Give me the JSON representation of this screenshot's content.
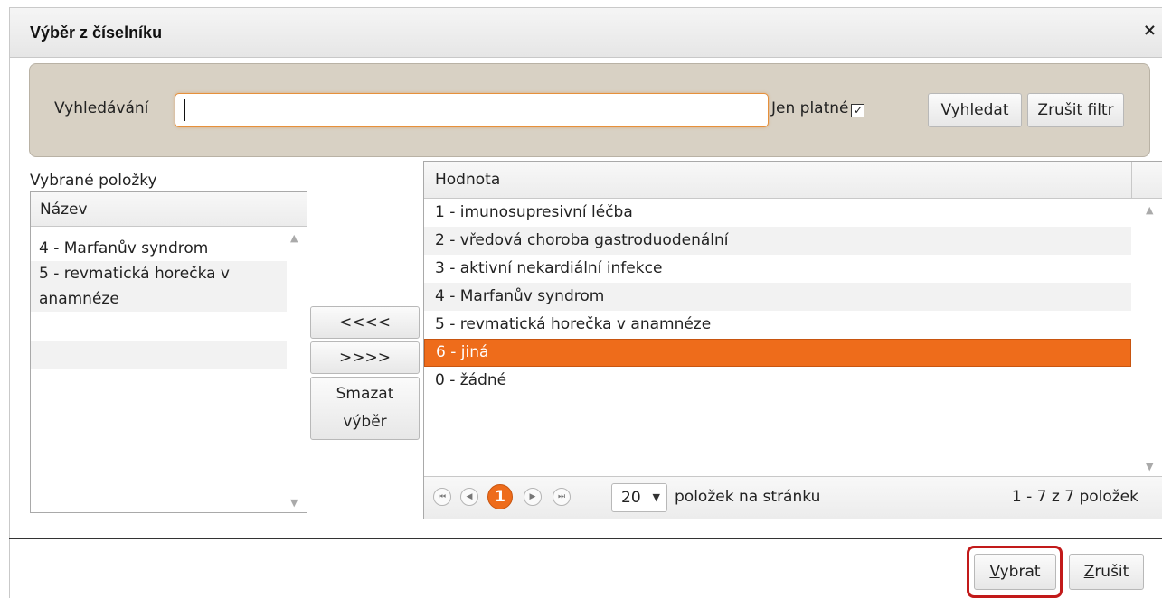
{
  "dialog": {
    "title": "Výběr z číselníku",
    "close_glyph": "×"
  },
  "search": {
    "label": "Vyhledávání",
    "value": "",
    "only_valid_label": "Jen platné",
    "only_valid_checked": true,
    "check_glyph": "✓",
    "search_button": "Vyhledat",
    "clear_filter_button": "Zrušit filtr"
  },
  "selected": {
    "caption": "Vybrané položky",
    "column_header": "Název",
    "rows": [
      "4 - Marfanův syndrom",
      "5 - revmatická horečka v",
      "anamnéze"
    ]
  },
  "move_buttons": {
    "remove": "<<<<",
    "add": ">>>>",
    "clear_selection_line1": "Smazat",
    "clear_selection_line2": "výběr"
  },
  "values": {
    "column_header": "Hodnota",
    "rows": [
      "1 - imunosupresivní léčba",
      "2 - vředová choroba gastroduodenální",
      "3 - aktivní nekardiální infekce",
      "4 - Marfanův syndrom",
      "5 - revmatická horečka v anamnéze",
      "6 - jiná",
      "0 - žádné"
    ],
    "selected_row": "6 - jiná"
  },
  "pager": {
    "first_glyph": "⏮",
    "prev_glyph": "◀",
    "current_page": "1",
    "next_glyph": "▶",
    "last_glyph": "⏭",
    "page_size": "20",
    "dropdown_glyph": "▼",
    "per_page_label": "položek na stránku",
    "info": "1 - 7 z 7 položek"
  },
  "footer": {
    "select_button_underlined": "V",
    "select_button_rest": "ybrat",
    "cancel_button_underlined": "Z",
    "cancel_button_rest": "rušit"
  },
  "colors": {
    "accent": "#ee6c1b",
    "panel": "#d8d1c4",
    "highlight_outline": "#c21a1a"
  }
}
